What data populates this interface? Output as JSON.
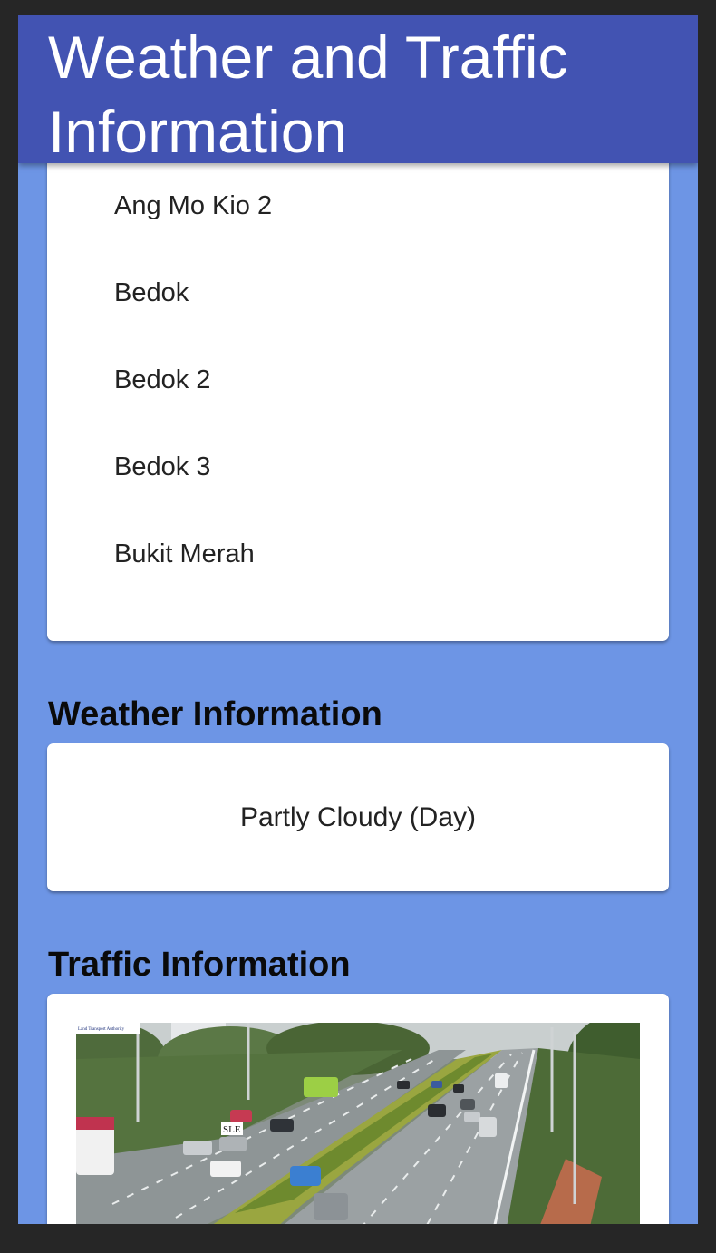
{
  "header": {
    "title": "Weather and Traffic Information"
  },
  "areas": {
    "items": [
      "Ang Mo Kio 2",
      "Bedok",
      "Bedok 2",
      "Bedok 3",
      "Bukit Merah"
    ]
  },
  "weather": {
    "title": "Weather Information",
    "forecast": "Partly Cloudy (Day)"
  },
  "traffic": {
    "title": "Traffic Information",
    "camera": {
      "logo_text": "Land Transport Authority",
      "road_sign": "SLE"
    }
  },
  "colors": {
    "header_bg": "#4253b2",
    "page_bg": "#6d95e5",
    "card_bg": "#ffffff",
    "window_bg": "#262626"
  }
}
